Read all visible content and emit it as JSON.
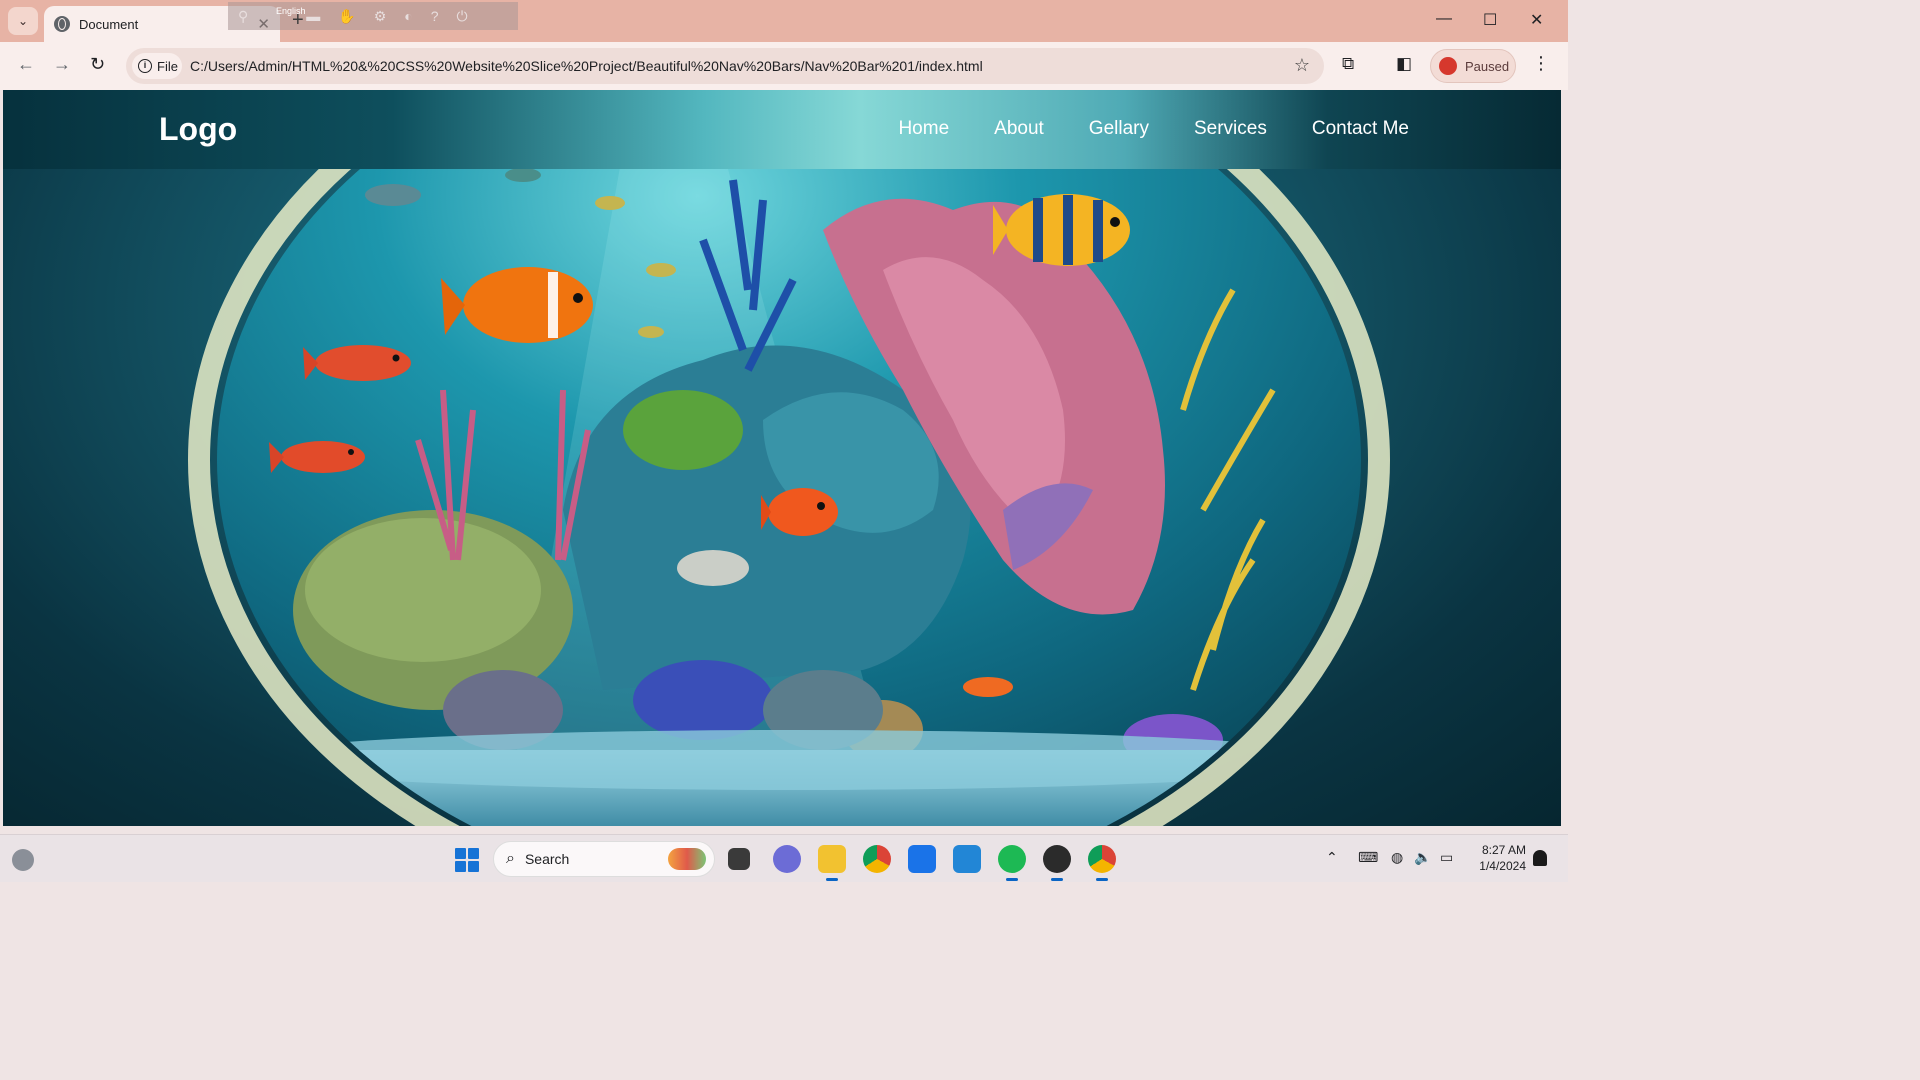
{
  "browser": {
    "tab_title": "Document",
    "overlay_lang": "English",
    "omnibox_chip": "File",
    "url": "C:/Users/Admin/HTML%20&%20CSS%20Website%20Slice%20Project/Beautiful%20Nav%20Bars/Nav%20Bar%201/index.html",
    "profile_label": "Paused"
  },
  "site": {
    "logo": "Logo",
    "nav": [
      "Home",
      "About",
      "Gellary",
      "Services",
      "Contact Me"
    ],
    "hero_subject": "aquarium"
  },
  "taskbar": {
    "search_label": "Search",
    "time": "8:27 AM",
    "date": "1/4/2024"
  },
  "colors": {
    "titlebar": "#e7b3a5",
    "toolbar": "#f9eeec",
    "nav_text": "#ffffff",
    "water_deep": "#0a3442"
  }
}
